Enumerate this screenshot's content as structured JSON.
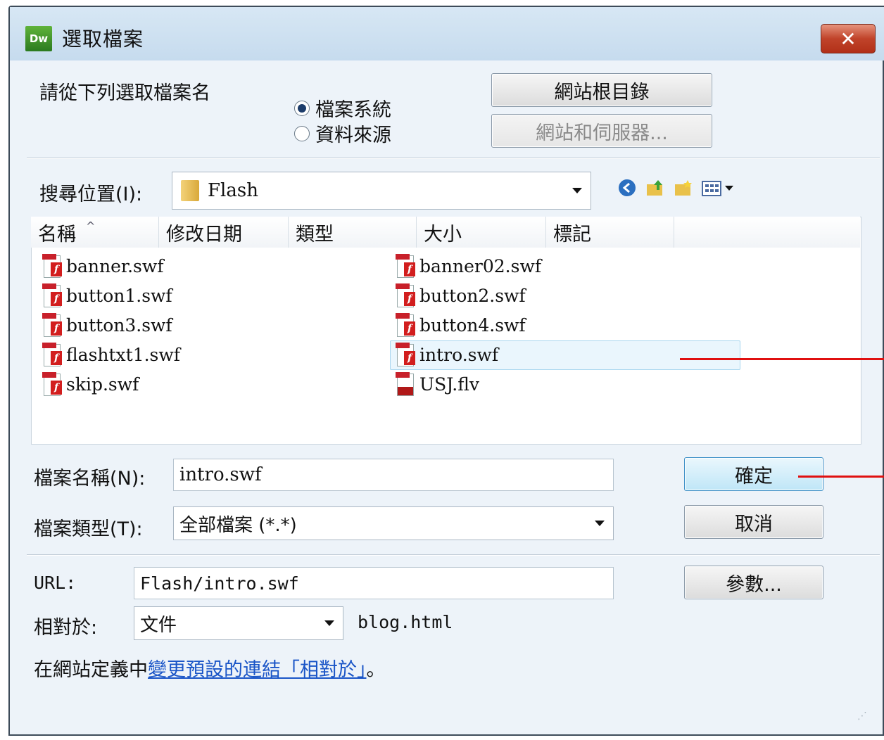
{
  "window": {
    "title": "選取檔案",
    "app_logo": "Dw",
    "close_symbol": "✕"
  },
  "source": {
    "prompt": "請從下列選取檔案名",
    "options": [
      "檔案系統",
      "資料來源"
    ],
    "selected": "檔案系統",
    "site_root_button": "網站根目錄",
    "sites_servers_button": "網站和伺服器..."
  },
  "lookin": {
    "label": "搜尋位置(I):",
    "value": "Flash"
  },
  "toolbar": {
    "icons": [
      "back-icon",
      "up-folder-icon",
      "new-folder-icon",
      "view-menu-icon"
    ]
  },
  "columns": [
    "名稱",
    "修改日期",
    "類型",
    "大小",
    "標記"
  ],
  "files": {
    "left": [
      "banner.swf",
      "button1.swf",
      "button3.swf",
      "flashtxt1.swf",
      "skip.swf"
    ],
    "right": [
      "banner02.swf",
      "button2.swf",
      "button4.swf",
      "intro.swf",
      "USJ.flv"
    ],
    "selected": "intro.swf"
  },
  "filename": {
    "label": "檔案名稱(N):",
    "value": "intro.swf"
  },
  "filetype": {
    "label": "檔案類型(T):",
    "value": "全部檔案 (*.*)"
  },
  "buttons": {
    "ok": "確定",
    "cancel": "取消",
    "params": "參數..."
  },
  "url": {
    "label": "URL:",
    "value": "Flash/intro.swf"
  },
  "relative": {
    "label": "相對於:",
    "value": "文件",
    "doc": "blog.html"
  },
  "footer": {
    "prefix": "在網站定義中",
    "link": "變更預設的連結「相對於」",
    "suffix": "。"
  },
  "colors": {
    "accent": "#1a55c7",
    "annotation": "#e01010"
  }
}
